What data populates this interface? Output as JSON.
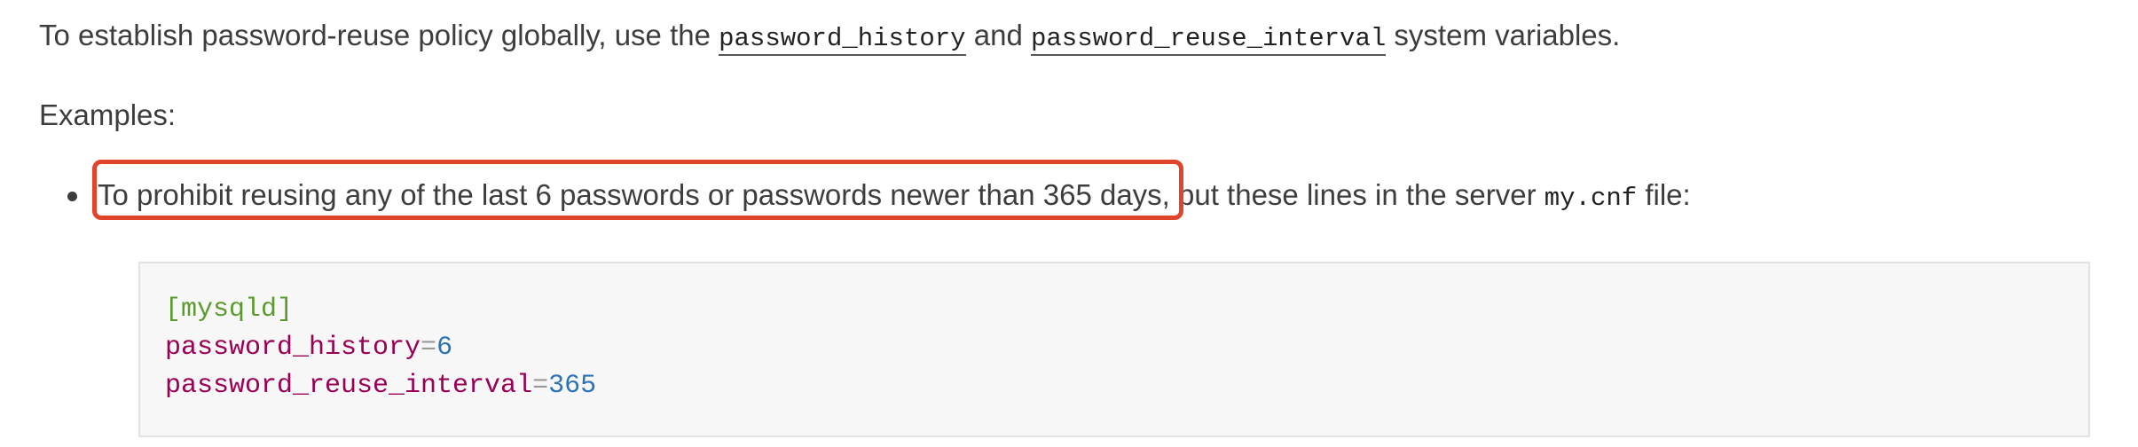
{
  "intro": {
    "prefix": "To establish password-reuse policy globally, use the ",
    "var1": "password_history",
    "mid": " and ",
    "var2": "password_reuse_interval",
    "suffix": " system variables."
  },
  "examples_label": "Examples:",
  "bullet": {
    "highlighted": "To prohibit reusing any of the last 6 passwords or passwords newer than 365 days,",
    "rest": " put these lines in the server ",
    "file": "my.cnf",
    "end": " file:"
  },
  "code": {
    "section": "[mysqld]",
    "line2_key": "password_history",
    "line2_eq": "=",
    "line2_val": "6",
    "line3_key": "password_reuse_interval",
    "line3_eq": "=",
    "line3_val": "365"
  },
  "colors": {
    "highlight_border": "#e0442b",
    "code_section": "#5b9b2e",
    "code_key": "#990055",
    "code_number": "#2b73b6"
  }
}
